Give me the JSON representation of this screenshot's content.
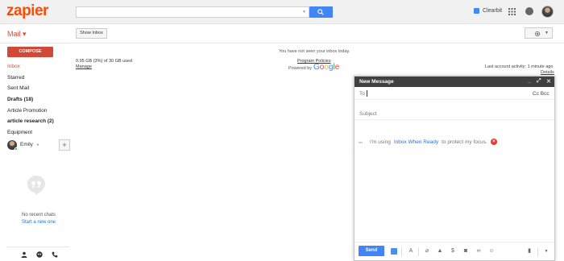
{
  "app": {
    "logo": "zapier"
  },
  "search": {
    "placeholder": ""
  },
  "topbar": {
    "clearbit_label": "Clearbit"
  },
  "header": {
    "mail_label": "Mail ▾",
    "show_inbox": "Show Inbox"
  },
  "sidebar": {
    "compose_label": "COMPOSE",
    "items": [
      {
        "label": "Inbox"
      },
      {
        "label": "Starred"
      },
      {
        "label": "Sent Mail"
      },
      {
        "label": "Drafts (18)"
      },
      {
        "label": "Article Promotion"
      },
      {
        "label": "article research (2)"
      },
      {
        "label": "Equipment"
      }
    ],
    "user_name": "Emily",
    "add_label": "+",
    "no_chats": "No recent chats",
    "start_new": "Start a new one"
  },
  "main": {
    "not_seen": "You have not seen your inbox today.",
    "storage": "0.95 GB (3%) of 30 GB used",
    "manage": "Manage",
    "program_policies": "Program Policies",
    "powered_by": "Powered by",
    "last_activity": "Last account activity: 1 minute ago",
    "details": "Details"
  },
  "compose_window": {
    "title": "New Message",
    "to_label": "To",
    "cc_bcc": "Cc  Bcc",
    "subject_placeholder": "Subject",
    "body_prefix": "I'm using",
    "body_link": "Inbox When Ready",
    "body_suffix": "to protect my focus.",
    "send_label": "Send"
  },
  "colors": {
    "brand": "#ff4a00",
    "accent_blue": "#4285f4",
    "compose_red": "#d14836",
    "compose_header": "#404040"
  }
}
